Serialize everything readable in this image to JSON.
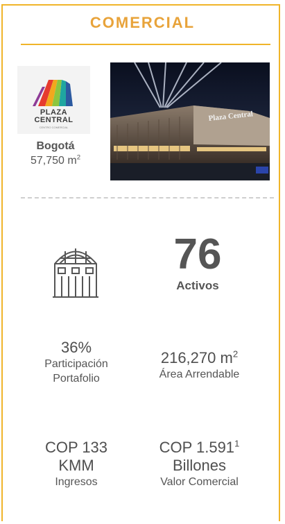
{
  "title": "COMERCIAL",
  "property": {
    "logo_text_line1": "PLAZA",
    "logo_text_line2": "CENTRAL",
    "logo_sub": "CENTRO COMERCIAL",
    "city": "Bogotá",
    "area_value": "57,750 m",
    "area_sup": "2",
    "photo_sign": "Plaza Central"
  },
  "kpi": {
    "assets_value": "76",
    "assets_label": "Activos"
  },
  "stats": {
    "participation_value": "36%",
    "participation_label_1": "Participación",
    "participation_label_2": "Portafolio",
    "leasable_value": "216,270 m",
    "leasable_sup": "2",
    "leasable_label": "Área Arrendable",
    "income_value_1": "COP 133",
    "income_value_2": "KMM",
    "income_label": "Ingresos",
    "commercial_value": "COP 1.591",
    "commercial_sup": "1",
    "commercial_value_2": "Billones",
    "commercial_label": "Valor Comercial"
  },
  "colors": {
    "accent": "#f0b429",
    "title": "#e8a33a",
    "text": "#4a4a4a"
  },
  "icons": [
    "plaza-central-logo-icon",
    "shopping-mall-icon"
  ]
}
